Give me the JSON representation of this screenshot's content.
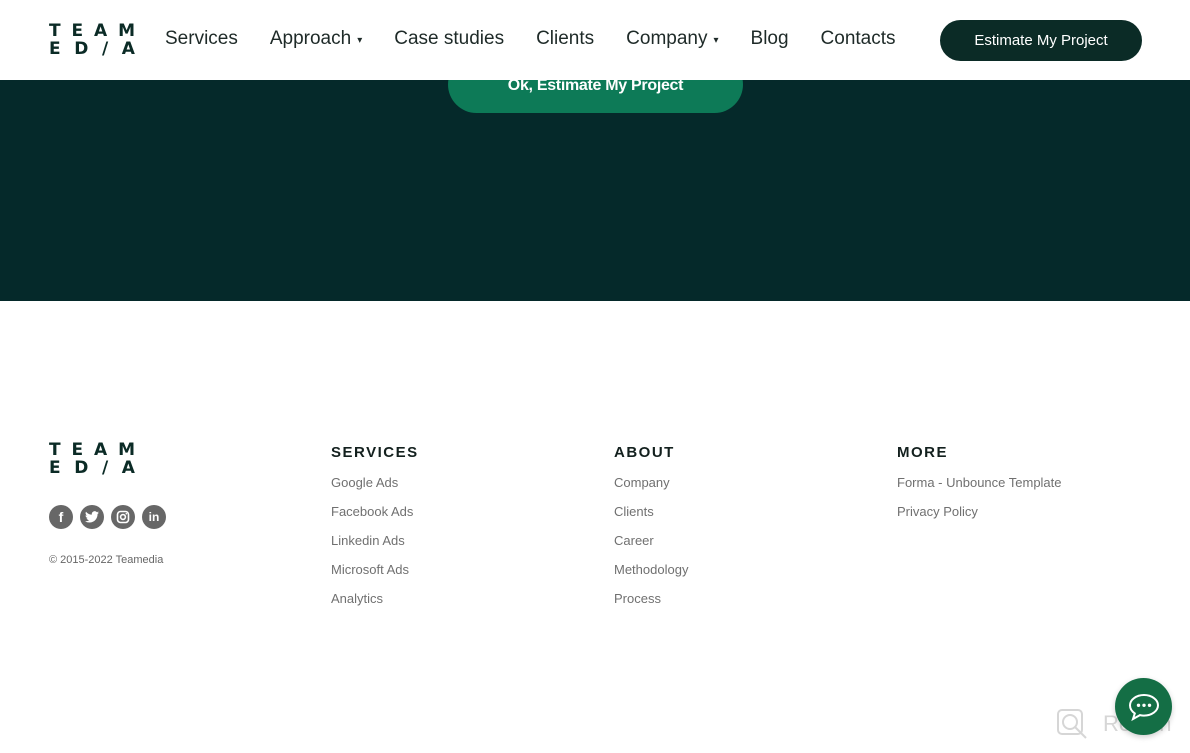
{
  "header": {
    "logo": {
      "line1": [
        "T",
        "E",
        "A",
        "M"
      ],
      "line2": [
        "E",
        "D",
        "/",
        "A"
      ]
    },
    "nav": [
      {
        "label": "Services",
        "dropdown": false
      },
      {
        "label": "Approach",
        "dropdown": true
      },
      {
        "label": "Case studies",
        "dropdown": false
      },
      {
        "label": "Clients",
        "dropdown": false
      },
      {
        "label": "Company",
        "dropdown": true
      },
      {
        "label": "Blog",
        "dropdown": false
      },
      {
        "label": "Contacts",
        "dropdown": false
      }
    ],
    "caret": "▾",
    "cta_label": "Estimate My Project"
  },
  "hero": {
    "cta_label": "Ok, Estimate My Project"
  },
  "footer": {
    "logo": {
      "line1": [
        "T",
        "E",
        "A",
        "M"
      ],
      "line2": [
        "E",
        "D",
        "/",
        "A"
      ]
    },
    "socials": [
      {
        "icon": "facebook-icon",
        "glyph": "f"
      },
      {
        "icon": "twitter-icon",
        "glyph": "t"
      },
      {
        "icon": "instagram-icon",
        "glyph": "◎"
      },
      {
        "icon": "linkedin-icon",
        "glyph": "in"
      }
    ],
    "copyright": "© 2015-2022 Teamedia",
    "columns": [
      {
        "title": "SERVICES",
        "links": [
          "Google Ads",
          "Facebook Ads",
          "Linkedin Ads",
          "Microsoft Ads",
          "Analytics"
        ]
      },
      {
        "title": "ABOUT",
        "links": [
          "Company",
          "Clients",
          "Career",
          "Methodology",
          "Process"
        ]
      },
      {
        "title": "MORE",
        "links": [
          "Forma - Unbounce Template",
          "Privacy Policy"
        ]
      }
    ]
  },
  "widgets": {
    "revain_label": "Revain"
  },
  "colors": {
    "brand_dark": "#0b2b26",
    "section_dark": "#05292a",
    "accent_green": "#0d7a57",
    "chat_green": "#146e45"
  }
}
